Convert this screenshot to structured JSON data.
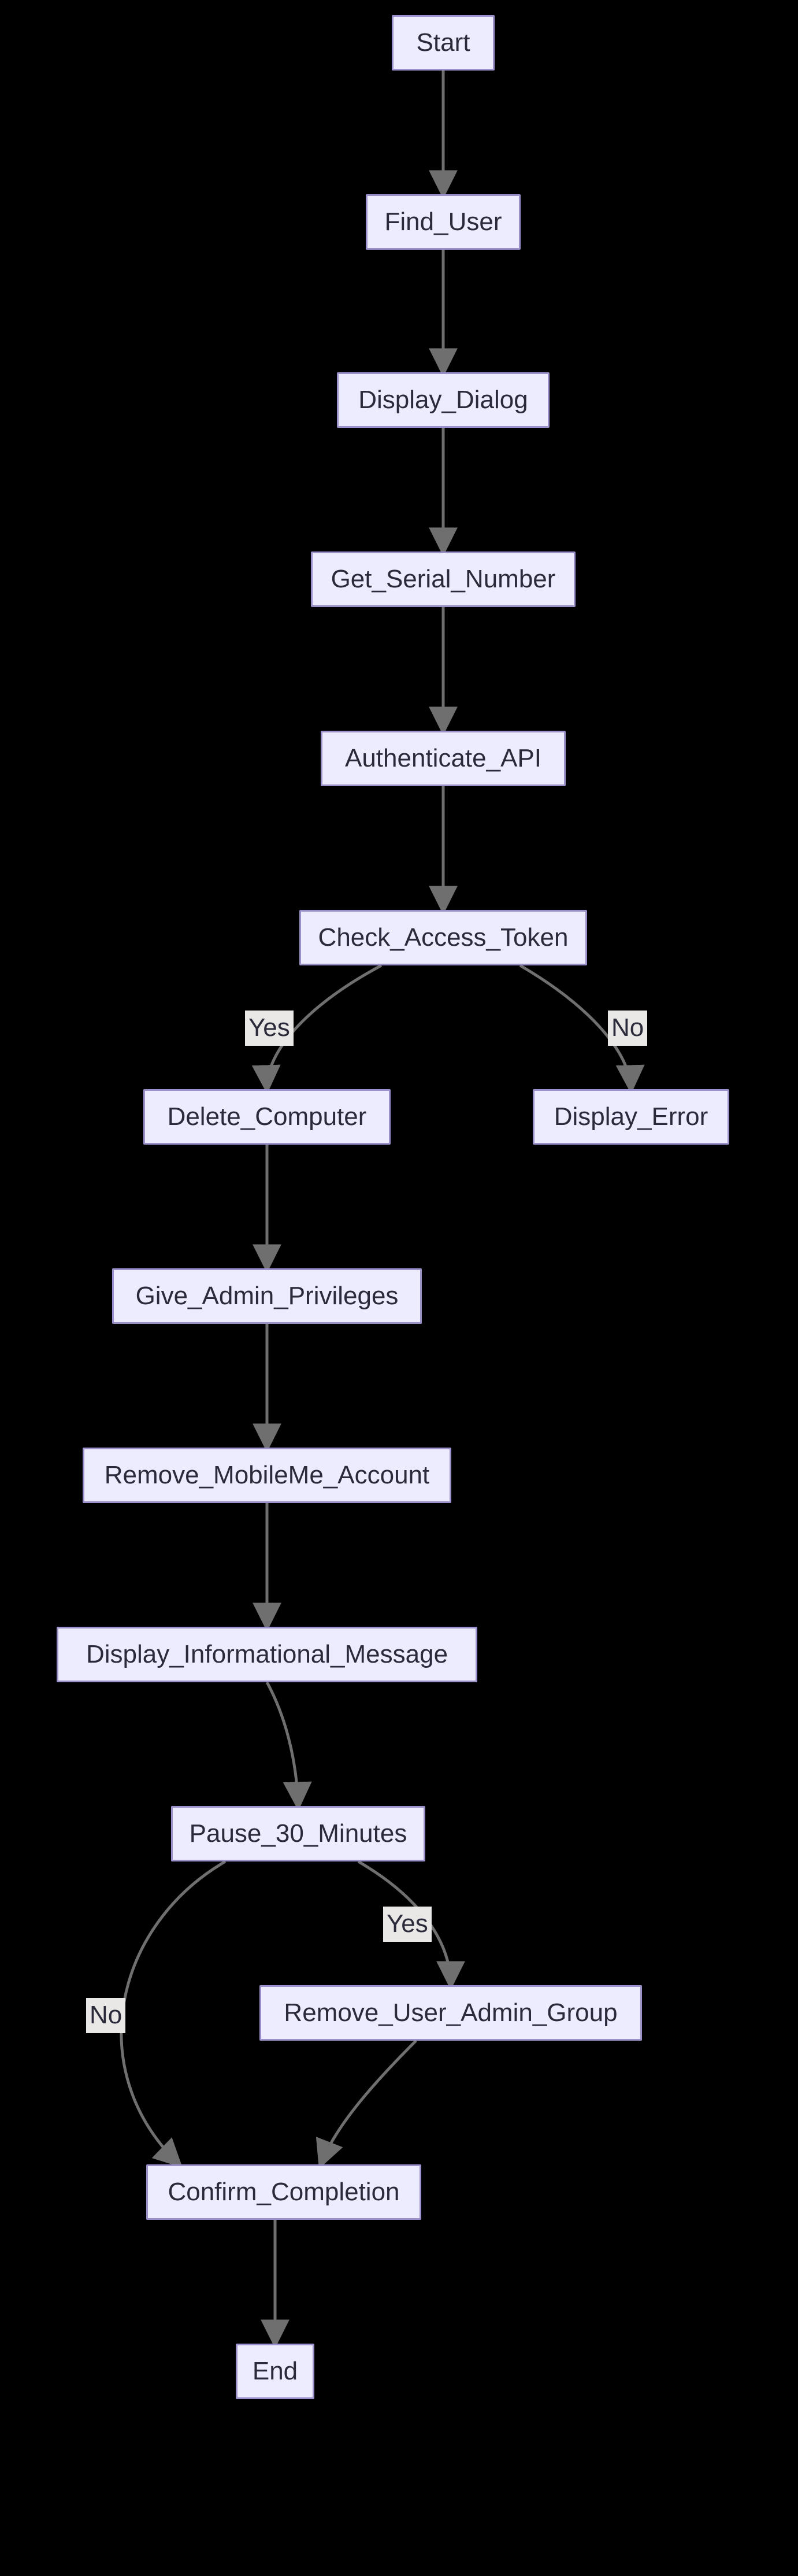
{
  "nodes": {
    "start": "Start",
    "find_user": "Find_User",
    "display_dialog": "Display_Dialog",
    "get_serial_number": "Get_Serial_Number",
    "authenticate_api": "Authenticate_API",
    "check_access_token": "Check_Access_Token",
    "delete_computer": "Delete_Computer",
    "display_error": "Display_Error",
    "give_admin_privileges": "Give_Admin_Privileges",
    "remove_mobileme_account": "Remove_MobileMe_Account",
    "display_informational_message": "Display_Informational_Message",
    "pause_30_minutes": "Pause_30_Minutes",
    "remove_user_admin_group": "Remove_User_Admin_Group",
    "confirm_completion": "Confirm_Completion",
    "end": "End"
  },
  "edge_labels": {
    "yes1": "Yes",
    "no1": "No",
    "yes2": "Yes",
    "no2": "No"
  },
  "chart_data": {
    "type": "flowchart",
    "title": "",
    "nodes": [
      "Start",
      "Find_User",
      "Display_Dialog",
      "Get_Serial_Number",
      "Authenticate_API",
      "Check_Access_Token",
      "Delete_Computer",
      "Display_Error",
      "Give_Admin_Privileges",
      "Remove_MobileMe_Account",
      "Display_Informational_Message",
      "Pause_30_Minutes",
      "Remove_User_Admin_Group",
      "Confirm_Completion",
      "End"
    ],
    "edges": [
      {
        "from": "Start",
        "to": "Find_User",
        "label": ""
      },
      {
        "from": "Find_User",
        "to": "Display_Dialog",
        "label": ""
      },
      {
        "from": "Display_Dialog",
        "to": "Get_Serial_Number",
        "label": ""
      },
      {
        "from": "Get_Serial_Number",
        "to": "Authenticate_API",
        "label": ""
      },
      {
        "from": "Authenticate_API",
        "to": "Check_Access_Token",
        "label": ""
      },
      {
        "from": "Check_Access_Token",
        "to": "Delete_Computer",
        "label": "Yes"
      },
      {
        "from": "Check_Access_Token",
        "to": "Display_Error",
        "label": "No"
      },
      {
        "from": "Delete_Computer",
        "to": "Give_Admin_Privileges",
        "label": ""
      },
      {
        "from": "Give_Admin_Privileges",
        "to": "Remove_MobileMe_Account",
        "label": ""
      },
      {
        "from": "Remove_MobileMe_Account",
        "to": "Display_Informational_Message",
        "label": ""
      },
      {
        "from": "Display_Informational_Message",
        "to": "Pause_30_Minutes",
        "label": ""
      },
      {
        "from": "Pause_30_Minutes",
        "to": "Remove_User_Admin_Group",
        "label": "Yes"
      },
      {
        "from": "Pause_30_Minutes",
        "to": "Confirm_Completion",
        "label": "No"
      },
      {
        "from": "Remove_User_Admin_Group",
        "to": "Confirm_Completion",
        "label": ""
      },
      {
        "from": "Confirm_Completion",
        "to": "End",
        "label": ""
      }
    ]
  }
}
